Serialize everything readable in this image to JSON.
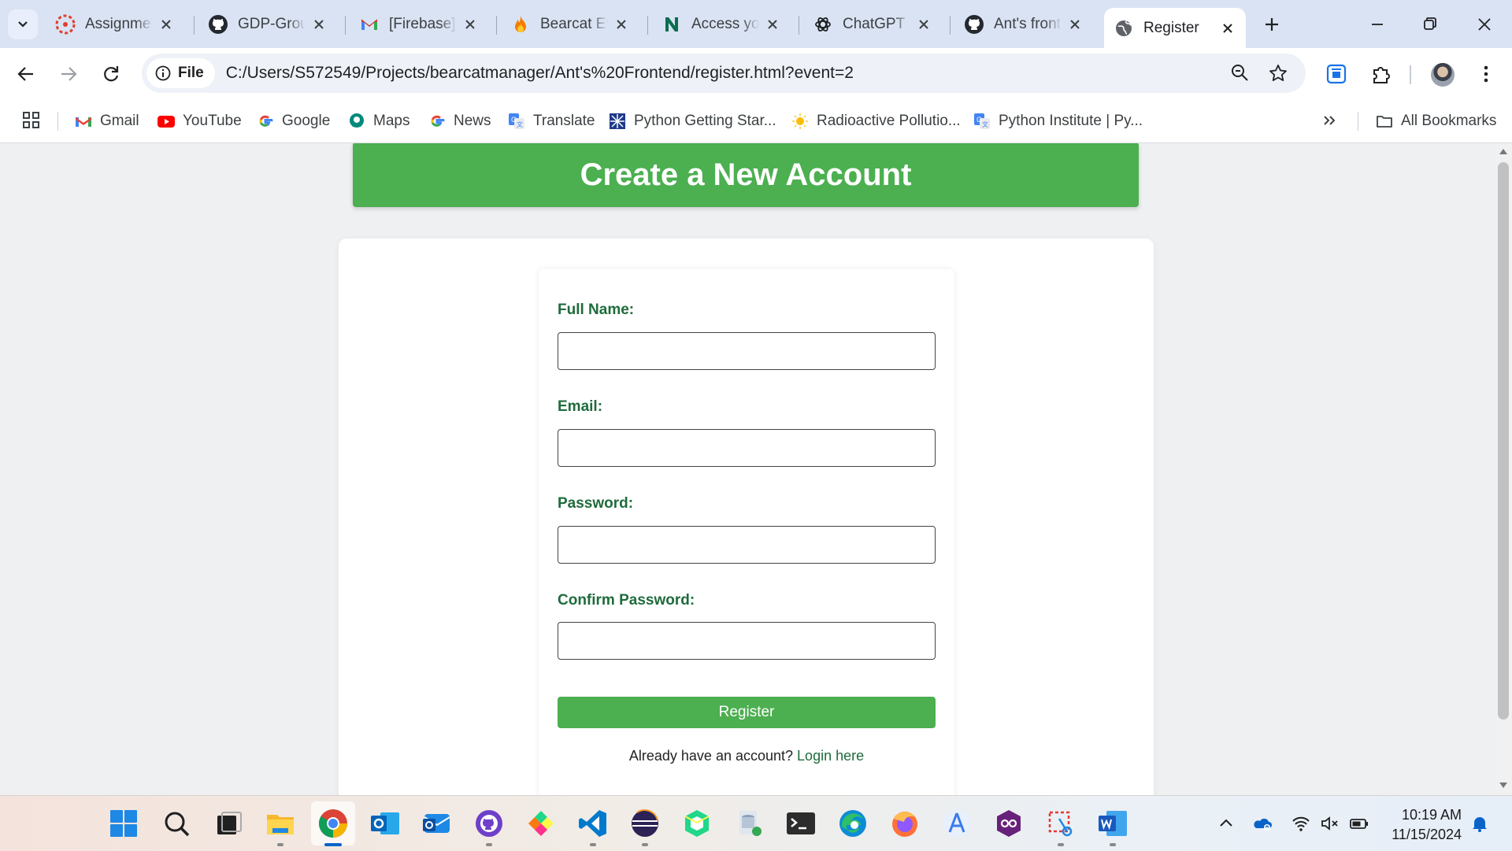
{
  "browser": {
    "tabs": [
      {
        "title": "Assignmen",
        "icon": "canvas-icon"
      },
      {
        "title": "GDP-Group",
        "icon": "github-icon"
      },
      {
        "title": "[Firebase]",
        "icon": "gmail-icon"
      },
      {
        "title": "Bearcat Ev",
        "icon": "firebase-icon"
      },
      {
        "title": "Access you",
        "icon": "notion-n-icon"
      },
      {
        "title": "ChatGPT",
        "icon": "chatgpt-icon"
      },
      {
        "title": "Ant's front",
        "icon": "github-icon"
      },
      {
        "title": "Register",
        "icon": "globe-icon",
        "active": true
      }
    ],
    "address": {
      "chip_label": "File",
      "url": "C:/Users/S572549/Projects/bearcatmanager/Ant's%20Frontend/register.html?event=2"
    },
    "bookmarks": [
      {
        "label": "Gmail",
        "icon": "gmail-icon"
      },
      {
        "label": "YouTube",
        "icon": "youtube-icon"
      },
      {
        "label": "Google",
        "icon": "google-icon"
      },
      {
        "label": "Maps",
        "icon": "maps-icon"
      },
      {
        "label": "News",
        "icon": "google-news-icon"
      },
      {
        "label": "Translate",
        "icon": "translate-icon"
      },
      {
        "label": "Python Getting Star...",
        "icon": "python-icon"
      },
      {
        "label": "Radioactive Pollutio...",
        "icon": "sun-icon"
      },
      {
        "label": "Python Institute | Py...",
        "icon": "translate-icon"
      }
    ],
    "all_bookmarks_label": "All Bookmarks"
  },
  "page": {
    "header_title": "Create a New Account",
    "form": {
      "fields": [
        {
          "label": "Full Name:",
          "value": ""
        },
        {
          "label": "Email:",
          "value": ""
        },
        {
          "label": "Password:",
          "value": ""
        },
        {
          "label": "Confirm Password:",
          "value": ""
        }
      ],
      "submit_label": "Register",
      "login_prompt": "Already have an account?",
      "login_link": "Login here"
    }
  },
  "taskbar": {
    "apps": [
      "start-icon",
      "search-icon",
      "task-view-icon",
      "file-explorer-icon",
      "chrome-icon",
      "outlook-icon",
      "outlook-new-icon",
      "github-desktop-icon",
      "pycharm-icon",
      "vscode-icon",
      "eclipse-icon",
      "cube-app-icon",
      "database-app-icon",
      "terminal-icon",
      "edge-icon",
      "firefox-icon",
      "android-studio-icon",
      "visual-studio-icon",
      "snipping-tool-icon",
      "word-icon"
    ],
    "time": "10:19 AM",
    "date": "11/15/2024"
  },
  "colors": {
    "accent_green": "#4caf50",
    "label_green": "#1f6b3c",
    "tabstrip_bg": "#dae3f3",
    "page_bg": "#eef0f2"
  }
}
